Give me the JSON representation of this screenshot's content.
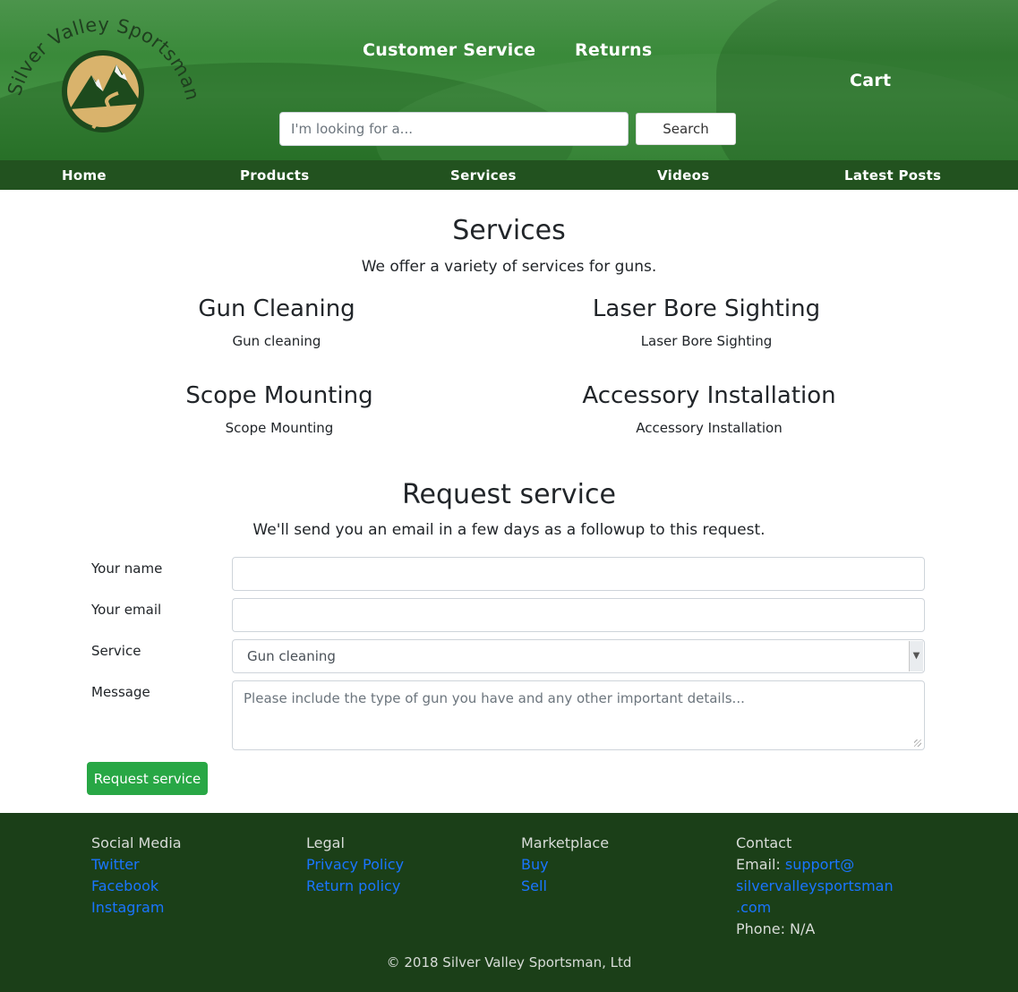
{
  "header": {
    "brand_name": "Silver Valley Sportsman",
    "links": {
      "customer_service": "Customer Service",
      "returns": "Returns",
      "cart": "Cart"
    },
    "search": {
      "placeholder": "I'm looking for a...",
      "button_label": "Search"
    }
  },
  "nav": {
    "items": [
      "Home",
      "Products",
      "Services",
      "Videos",
      "Latest Posts"
    ]
  },
  "services": {
    "title": "Services",
    "subtitle": "We offer a variety of services for guns.",
    "items": [
      {
        "title": "Gun Cleaning",
        "desc": "Gun cleaning"
      },
      {
        "title": "Laser Bore Sighting",
        "desc": "Laser Bore Sighting"
      },
      {
        "title": "Scope Mounting",
        "desc": "Scope Mounting"
      },
      {
        "title": "Accessory Installation",
        "desc": "Accessory Installation"
      }
    ]
  },
  "request": {
    "title": "Request service",
    "subtitle": "We'll send you an email in a few days as a followup to this request.",
    "fields": {
      "name_label": "Your name",
      "email_label": "Your email",
      "service_label": "Service",
      "service_value": "Gun cleaning",
      "message_label": "Message",
      "message_placeholder": "Please include the type of gun you have and any other important details..."
    },
    "submit_label": "Request service"
  },
  "footer": {
    "social": {
      "heading": "Social Media",
      "links": [
        "Twitter",
        "Facebook",
        "Instagram"
      ]
    },
    "legal": {
      "heading": "Legal",
      "links": [
        "Privacy Policy",
        "Return policy"
      ]
    },
    "marketplace": {
      "heading": "Marketplace",
      "links": [
        "Buy",
        "Sell"
      ]
    },
    "contact": {
      "heading": "Contact",
      "email_label": "Email:",
      "email_part1": "support@",
      "email_part2": "silvervalleysportsman",
      "email_part3": ".com",
      "phone": "Phone: N/A"
    },
    "copyright": "© 2018 Silver Valley Sportsman, Ltd"
  },
  "colors": {
    "header_green": "#3a8a3a",
    "nav_green": "#22521f",
    "footer_green": "#1b3f18",
    "button_green": "#28a745",
    "link_blue": "#1a75ff",
    "logo_tan": "#d9b36c"
  }
}
